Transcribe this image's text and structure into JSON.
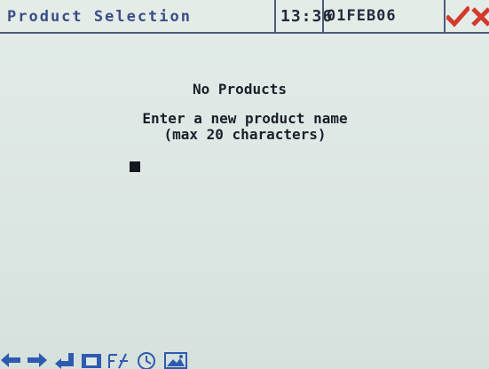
{
  "header": {
    "title": "Product Selection",
    "time": "13:36",
    "date": "01FEB06",
    "ok_icon": "checkmark-icon",
    "cancel_icon": "x-icon"
  },
  "main": {
    "message": "No Products",
    "prompt_line1": "Enter a new product name",
    "prompt_line2": "(max 20 characters)",
    "input_value": ""
  },
  "toolbar": {
    "icons": [
      "arrow-left-icon",
      "arrow-right-icon",
      "enter-icon",
      "screen-icon",
      "function-icon",
      "clock-icon",
      "picture-icon"
    ]
  },
  "colors": {
    "background": "#dfe8e4",
    "title": "#3a4d86",
    "text": "#1c1f29",
    "ok": "#d33a2c",
    "cancel": "#d33a2c",
    "toolbar": "#2e5bb0"
  }
}
